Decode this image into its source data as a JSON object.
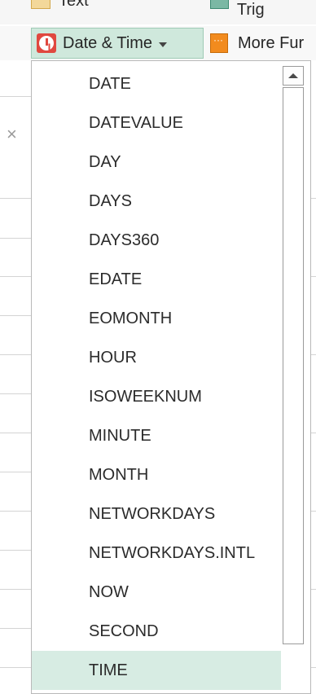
{
  "ribbon": {
    "row1": {
      "text_button": "Text",
      "math_button": "Math & Trig"
    },
    "date_time_button": "Date & Time",
    "more_functions_button": "More Fur"
  },
  "dropdown": {
    "items": [
      {
        "label": "DATE"
      },
      {
        "label": "DATEVALUE"
      },
      {
        "label": "DAY"
      },
      {
        "label": "DAYS"
      },
      {
        "label": "DAYS360"
      },
      {
        "label": "EDATE"
      },
      {
        "label": "EOMONTH"
      },
      {
        "label": "HOUR"
      },
      {
        "label": "ISOWEEKNUM"
      },
      {
        "label": "MINUTE"
      },
      {
        "label": "MONTH"
      },
      {
        "label": "NETWORKDAYS"
      },
      {
        "label": "NETWORKDAYS.INTL"
      },
      {
        "label": "NOW"
      },
      {
        "label": "SECOND"
      },
      {
        "label": "TIME"
      }
    ],
    "selected_label": "TIME"
  },
  "colors": {
    "selected_bg": "#d7ece3",
    "button_active_bg": "#cfe8dc",
    "date_icon": "#e0483f",
    "more_icon": "#f28b1e"
  },
  "sheet": {
    "close_glyph": "×"
  }
}
